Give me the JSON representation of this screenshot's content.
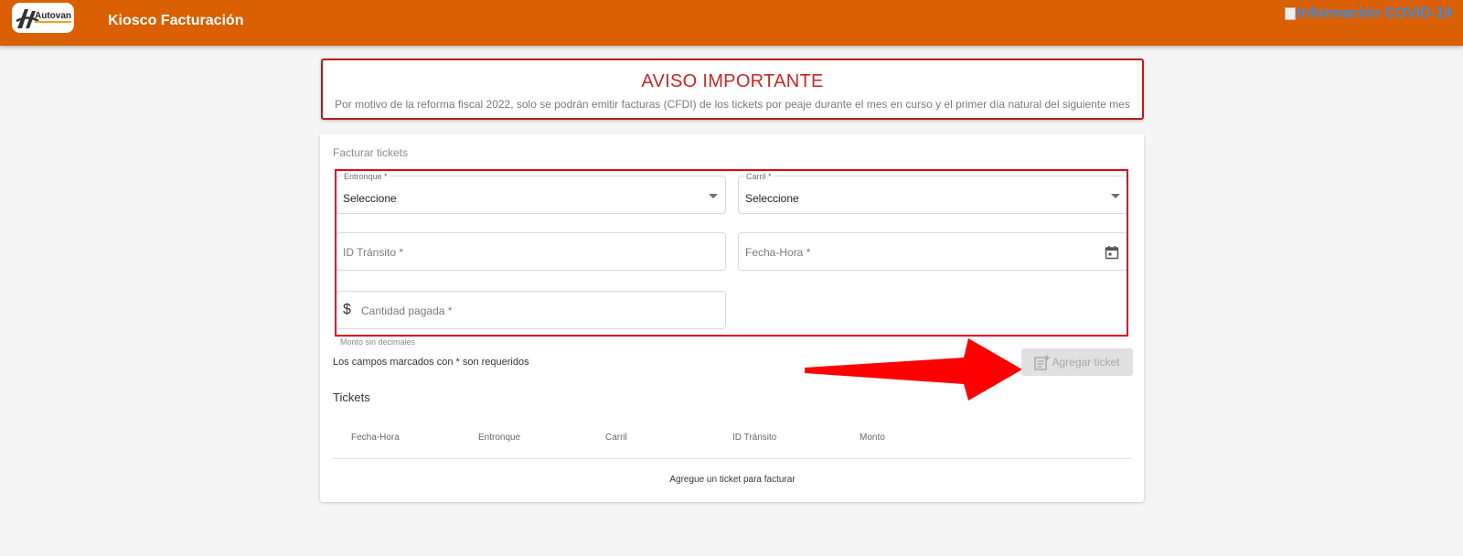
{
  "header": {
    "logo_text": "Autovan",
    "title": "Kiosco Facturación",
    "covid_link": "Información COVID-19",
    "color": "#d95f00"
  },
  "notice": {
    "title": "AVISO IMPORTANTE",
    "text": "Por motivo de la reforma fiscal 2022, solo se podrán emitir facturas (CFDI) de los tickets por peaje durante el mes en curso y el primer día natural del siguiente mes"
  },
  "form": {
    "section_title": "Facturar tickets",
    "entronque": {
      "label": "Entronque *",
      "value": "Seleccione"
    },
    "carril": {
      "label": "Carril *",
      "value": "Seleccione"
    },
    "id_transito": {
      "placeholder": "ID Tránsito *"
    },
    "fecha_hora": {
      "placeholder": "Fecha-Hora *"
    },
    "cantidad": {
      "placeholder": "Cantidad pagada *",
      "hint": "Monto sin decimales"
    },
    "required_note": "Los campos marcados con * son requeridos",
    "add_button": "Agregar ticket"
  },
  "tickets": {
    "title": "Tickets",
    "columns": [
      "Fecha-Hora",
      "Entronque",
      "Carril",
      "ID Tránsito",
      "Monto"
    ],
    "empty_message": "Agregue un ticket para facturar"
  },
  "colors": {
    "annotation_red": "#e0001b",
    "notice_red": "#c62828"
  },
  "icons": [
    "logo-icon",
    "dropdown-arrow-icon",
    "calendar-icon",
    "dollar-icon",
    "add-note-icon",
    "arrow-annotation"
  ]
}
